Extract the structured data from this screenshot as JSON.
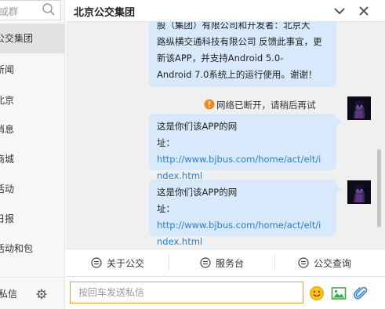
{
  "sidebar": {
    "search_placeholder": "或群",
    "items": [
      {
        "label": "公交集团",
        "active": true
      },
      {
        "label": "新闻"
      },
      {
        "label": "北京"
      },
      {
        "label": "消息"
      },
      {
        "label": "商城"
      },
      {
        "label": "活动"
      },
      {
        "label": "日报"
      },
      {
        "label": "活动和包"
      }
    ],
    "footer_label": "私信"
  },
  "chat": {
    "title": "北京公交集团",
    "messages": [
      {
        "line1": "股（集团）有限公司和开发者：北京大",
        "line2": "路纵横交通科技有限公司 反馈此事宜，更",
        "line3": "新该APP，并支持Android 5.0-",
        "line4": "Android 7.0系统上的运行使用。谢谢！"
      },
      {
        "text": "这是你们该APP的网",
        "label": "址：",
        "link1": "http://www.bjbus.com/home/act/elt/i",
        "link2": "ndex.html"
      },
      {
        "text": "这是你们该APP的网",
        "label": "址：",
        "link1": "http://www.bjbus.com/home/act/elt/i",
        "link2": "ndex.html"
      }
    ],
    "status_text": "网络已断开，请稍后再试"
  },
  "menu": [
    {
      "label": "关于公交"
    },
    {
      "label": "服务台"
    },
    {
      "label": "公交查询"
    }
  ],
  "input": {
    "placeholder": "按回车发送私信"
  },
  "colors": {
    "bubble": "#d7e9fa",
    "link": "#2a7fcf",
    "warning": "#f08a1c",
    "input_border": "#f0a030"
  }
}
